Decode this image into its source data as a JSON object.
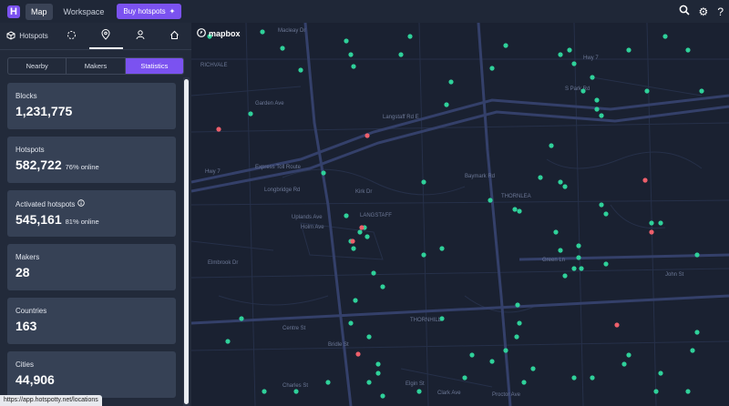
{
  "app": {
    "logo_letter": "H"
  },
  "nav": {
    "map": "Map",
    "workspace": "Workspace",
    "buy": "Buy hotspots"
  },
  "tabs": {
    "hotspots": "Hotspots"
  },
  "segment": {
    "nearby": "Nearby",
    "makers": "Makers",
    "statistics": "Statistics"
  },
  "cards": [
    {
      "label": "Blocks",
      "value": "1,231,775",
      "sub": ""
    },
    {
      "label": "Hotspots",
      "value": "582,722",
      "sub": "76% online"
    },
    {
      "label": "Activated hotspots",
      "value": "545,161",
      "sub": "81% online"
    },
    {
      "label": "Makers",
      "value": "28",
      "sub": ""
    },
    {
      "label": "Countries",
      "value": "163",
      "sub": ""
    },
    {
      "label": "Cities",
      "value": "44,906",
      "sub": ""
    }
  ],
  "map": {
    "brand": "mapbox",
    "labels": [
      "RICHVALE",
      "Garden Ave",
      "Hwy 7",
      "Express Toll Route",
      "Langstaff Rd E",
      "Longbridge Rd",
      "Uplands Ave",
      "Holm Ave",
      "LANGSTAFF",
      "Kirk Dr",
      "Baymark Rd",
      "THORNLEA",
      "Green Ln",
      "John St",
      "Centre St",
      "THORNHILL",
      "Clark Ave",
      "Elgin St",
      "Proctor Ave",
      "Elmbrook Dr",
      "Bridle St",
      "Charles St",
      "Macleay Dr",
      "S Park Rd",
      "Hwy 7"
    ],
    "colors": {
      "online": "#2fd19a",
      "offline": "#ee5f6b"
    }
  },
  "status_url": "https://app.hotspotty.net/locations"
}
